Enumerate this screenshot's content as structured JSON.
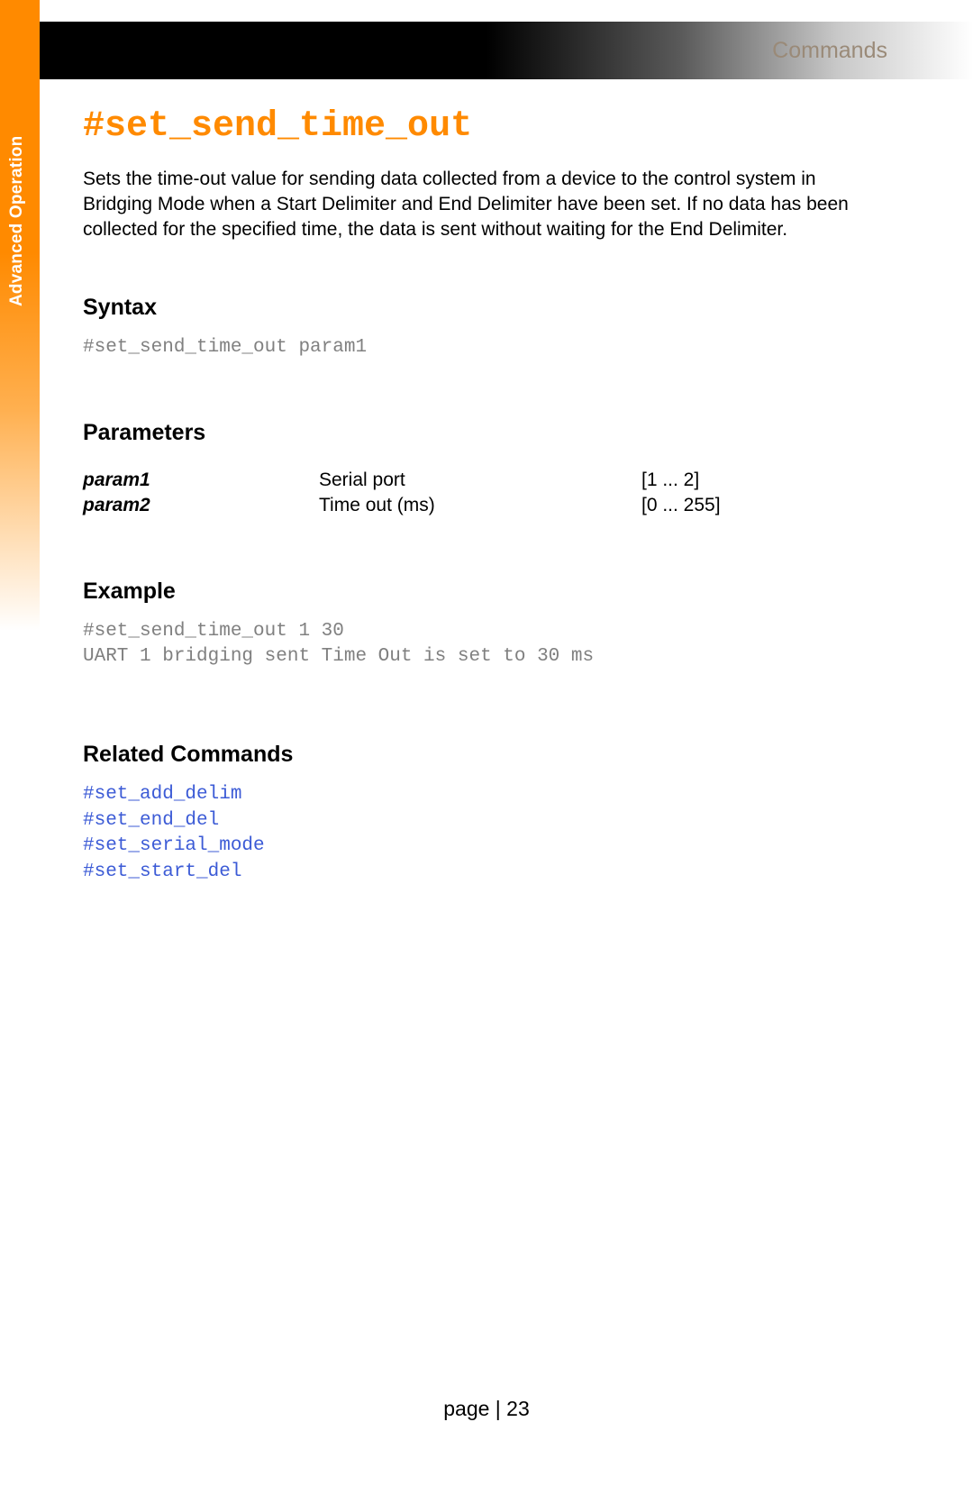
{
  "sidebar": {
    "label": "Advanced Operation"
  },
  "header": {
    "section": "Commands"
  },
  "command": {
    "title": "#set_send_time_out",
    "description": "Sets the time-out value for sending data collected from a device to the control system in Bridging Mode when a Start Delimiter and End Delimiter have been set. If no data has been collected for the specified time, the data is sent without waiting for the End Delimiter."
  },
  "sections": {
    "syntax": {
      "heading": "Syntax",
      "code": "#set_send_time_out param1"
    },
    "parameters": {
      "heading": "Parameters",
      "rows": [
        {
          "name": "param1",
          "desc": "Serial port",
          "range": "[1 ... 2]"
        },
        {
          "name": "param2",
          "desc": "Time out (ms)",
          "range": "[0 ... 255]"
        }
      ]
    },
    "example": {
      "heading": "Example",
      "code": "#set_send_time_out 1 30\nUART 1 bridging sent Time Out is set to 30 ms"
    },
    "related": {
      "heading": "Related Commands",
      "links": [
        "#set_add_delim",
        "#set_end_del",
        "#set_serial_mode",
        "#set_start_del"
      ]
    }
  },
  "footer": {
    "page_label": "page | 23"
  }
}
